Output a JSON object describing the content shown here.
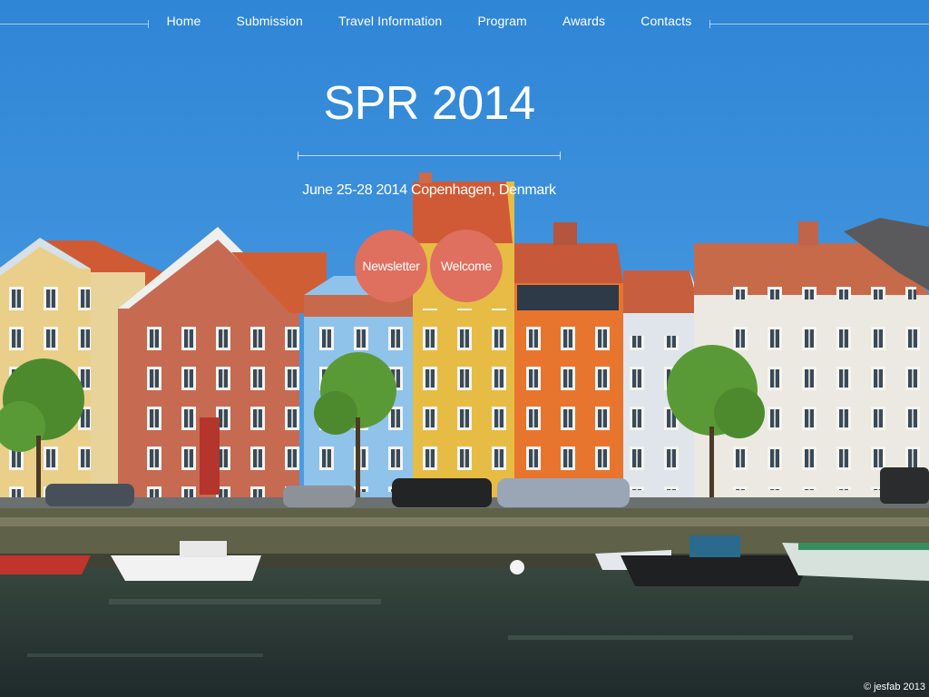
{
  "nav": {
    "items": [
      {
        "label": "Home"
      },
      {
        "label": "Submission"
      },
      {
        "label": "Travel Information"
      },
      {
        "label": "Program"
      },
      {
        "label": "Awards"
      },
      {
        "label": "Contacts"
      }
    ]
  },
  "hero": {
    "title": "SPR 2014",
    "subtitle": "June 25-28 2014 Copenhagen, Denmark"
  },
  "buttons": {
    "newsletter": "Newsletter",
    "welcome": "Welcome"
  },
  "photo_credit": "© jesfab 2013",
  "colors": {
    "sky": "#3f8fd8",
    "button": "#df6f5e",
    "water": "#2f3c3a"
  }
}
